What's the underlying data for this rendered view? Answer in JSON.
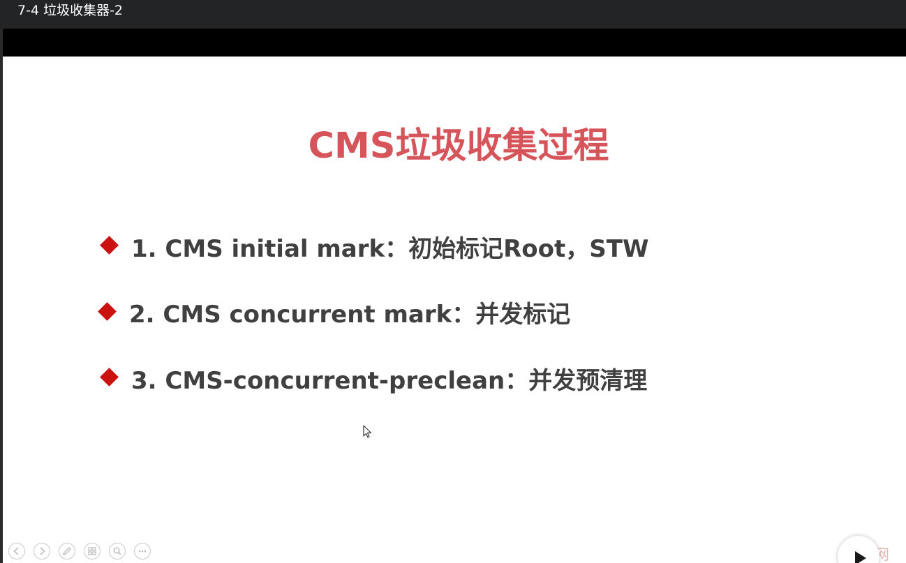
{
  "window": {
    "title": "7-4 垃圾收集器-2"
  },
  "slide": {
    "title": "CMS垃圾收集过程",
    "bullets": [
      {
        "text": "1. CMS initial mark：初始标记Root，STW"
      },
      {
        "text": "2. CMS concurrent mark：并发标记"
      },
      {
        "text": "3. CMS-concurrent-preclean：并发预清理"
      }
    ]
  },
  "watermark": {
    "text": "课网"
  },
  "colors": {
    "title": "#d5555b",
    "bullet_marker": "#cc1111",
    "bullet_text": "#404040",
    "titlebar": "#232425"
  },
  "controls": [
    {
      "icon": "previous-slide-icon"
    },
    {
      "icon": "next-slide-icon"
    },
    {
      "icon": "pen-icon"
    },
    {
      "icon": "slide-sorter-icon"
    },
    {
      "icon": "zoom-icon"
    },
    {
      "icon": "more-options-icon"
    }
  ]
}
